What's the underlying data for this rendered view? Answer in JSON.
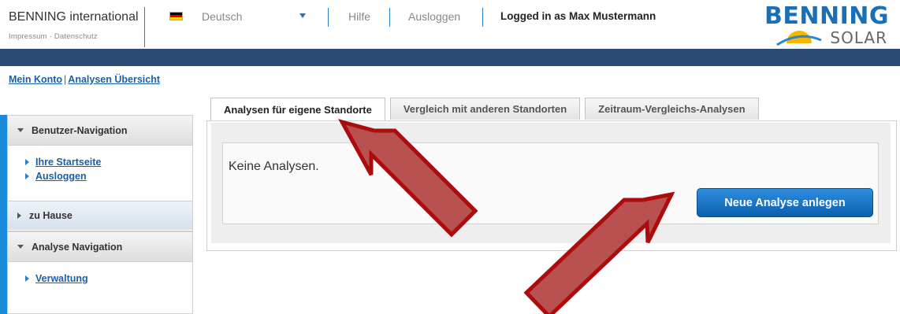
{
  "header": {
    "brand": "BENNING international",
    "legal": "Impressum · Datenschutz",
    "language": "Deutsch",
    "help": "Hilfe",
    "logout": "Ausloggen",
    "login_info": "Logged in as Max Mustermann",
    "logo_main": "BENNING",
    "logo_sub": "SOLAR"
  },
  "breadcrumb": {
    "item1": "Mein Konto",
    "separator": "|",
    "item2": "Analysen Übersicht"
  },
  "sidebar": {
    "user_nav": {
      "title": "Benutzer-Navigation",
      "links": [
        "Ihre Startseite",
        "Ausloggen"
      ]
    },
    "home": {
      "title": "zu Hause"
    },
    "analysis_nav": {
      "title": "Analyse Navigation",
      "links": [
        "Verwaltung"
      ]
    }
  },
  "tabs": [
    {
      "label": "Analysen für eigene Standorte",
      "active": true
    },
    {
      "label": "Vergleich mit anderen Standorten",
      "active": false
    },
    {
      "label": "Zeitraum-Vergleichs-Analysen",
      "active": false
    }
  ],
  "content": {
    "empty_message": "Keine Analysen.",
    "new_button": "Neue Analyse anlegen"
  },
  "colors": {
    "nav_bar": "#2c4a76",
    "link": "#1a5fa8",
    "accent_blue": "#1a8bd8",
    "annotation_arrow": "#b23a3a"
  }
}
